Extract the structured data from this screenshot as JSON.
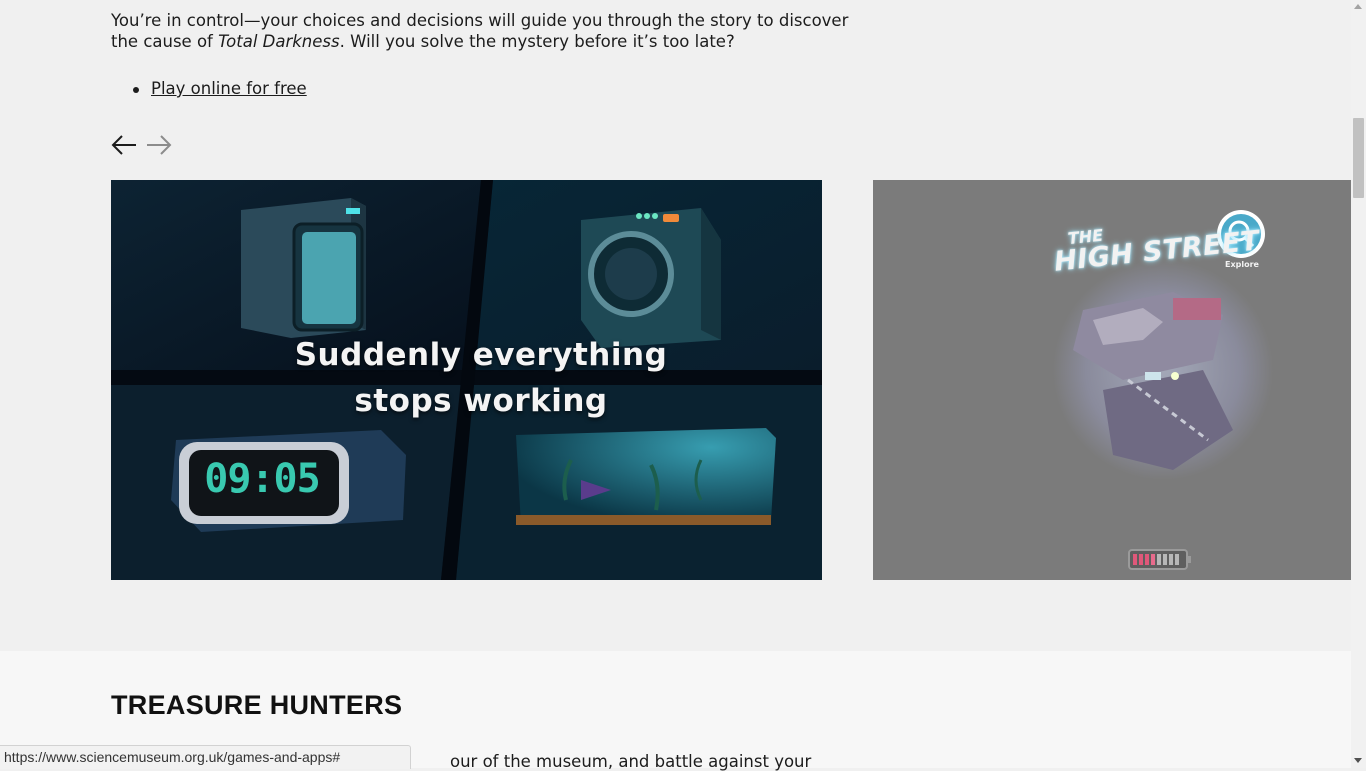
{
  "intro": {
    "text_before": "You’re in control—your choices and decisions will guide you through the story to discover the cause of ",
    "emphasis": "Total Darkness",
    "text_after": ". Will you solve the mystery before it’s too late?"
  },
  "links": [
    {
      "label": "Play online for free"
    }
  ],
  "carousel": {
    "prev_icon": "arrow-left-icon",
    "next_icon": "arrow-right-icon",
    "slides": [
      {
        "caption_line1": "Suddenly  everything",
        "caption_line2": "stops  working",
        "clock_display": "09:05"
      },
      {
        "title_small": "THE",
        "title_main": "HIGH STREET",
        "explore_label": "Explore",
        "explore_icon": "magnifier-icon",
        "battery_icon": "battery-icon"
      }
    ]
  },
  "section": {
    "title": "TREASURE HUNTERS",
    "description_visible": "our of the museum, and battle against your"
  },
  "status_bar": {
    "url": "https://www.sciencemuseum.org.uk/games-and-apps#"
  },
  "colors": {
    "page_background": "#f0f0f0",
    "text": "#1c1c1c",
    "slide1_background": "#08121f",
    "slide2_background": "#7b7b7b",
    "accent_teal": "#39c9b0"
  }
}
